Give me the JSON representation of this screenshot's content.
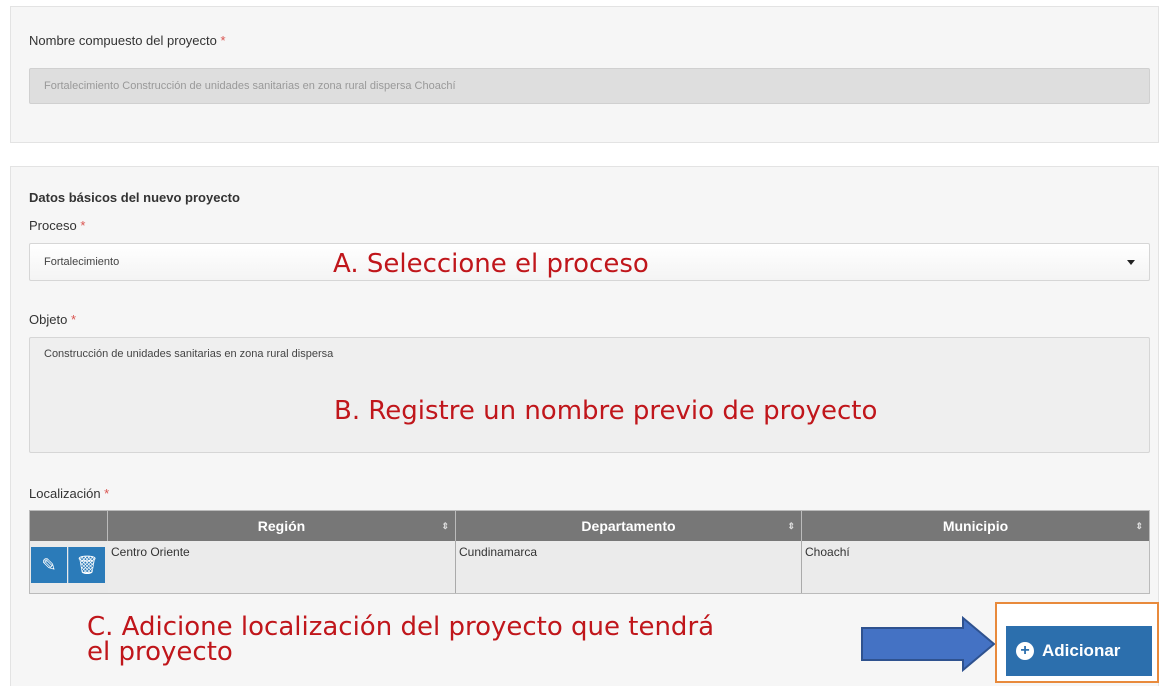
{
  "compound": {
    "label": "Nombre compuesto del proyecto",
    "required_mark": "*",
    "value": "Fortalecimiento Construcción de unidades sanitarias en zona rural dispersa  Choachí"
  },
  "basic": {
    "heading": "Datos básicos del nuevo proyecto",
    "process_label": "Proceso",
    "process_value": "Fortalecimiento",
    "object_label": "Objeto",
    "object_value": "Construcción de unidades sanitarias en zona rural dispersa",
    "location_label": "Localización",
    "required_mark": "*"
  },
  "annotations": {
    "a": "A. Seleccione el proceso",
    "b": "B. Registre un nombre previo de proyecto",
    "c_line1": "C. Adicione localización del proyecto que tendrá",
    "c_line2": "el proyecto"
  },
  "table": {
    "columns": [
      "Región",
      "Departamento",
      "Municipio"
    ],
    "rows": [
      [
        "Centro Oriente",
        "Cundinamarca",
        "Choachí"
      ]
    ]
  },
  "actions": {
    "add_label": "Adicionar"
  },
  "icons": {
    "edit": "pencil-icon",
    "delete": "trash-icon",
    "add": "plus-circle-icon",
    "arrow": "right-arrow-icon"
  },
  "colors": {
    "annotation": "#c0161b",
    "button": "#2c6fad",
    "highlight": "#e88a3c",
    "arrow_fill": "#4472c4"
  }
}
